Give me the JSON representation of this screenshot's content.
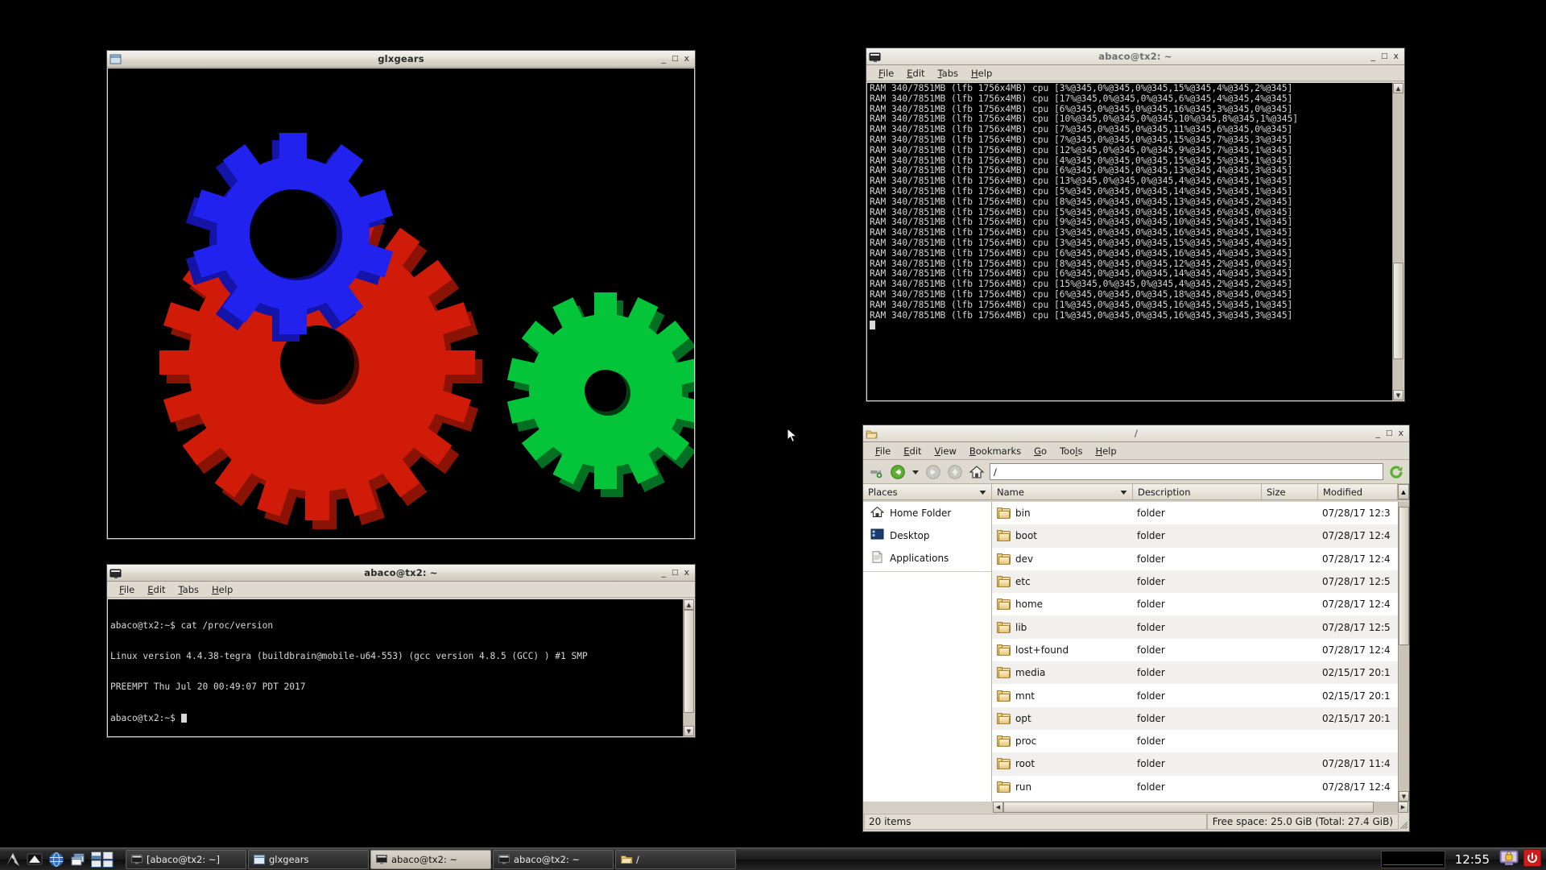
{
  "desktop": {
    "background_color": "#000000"
  },
  "glxgears_window": {
    "title": "glxgears",
    "icon": "window-icon",
    "buttons": {
      "minimize": "_",
      "maximize": "❐",
      "close": "x"
    },
    "gears": [
      {
        "name": "blue-gear",
        "color": "#2222ee",
        "shadow_color": "#1414a8",
        "teeth": 10
      },
      {
        "name": "red-gear",
        "color": "#d01b08",
        "shadow_color": "#7a1004",
        "teeth": 20
      },
      {
        "name": "green-gear",
        "color": "#04c43a",
        "shadow_color": "#036f23",
        "teeth": 14
      }
    ]
  },
  "terminal_top": {
    "title": "abaco@tx2: ~",
    "icon": "terminal-icon",
    "menu": [
      "File",
      "Edit",
      "Tabs",
      "Help"
    ],
    "buttons": {
      "minimize": "_",
      "maximize": "❐",
      "close": "x"
    },
    "lines": [
      "RAM 340/7851MB (lfb 1756x4MB) cpu [3%@345,0%@345,0%@345,15%@345,4%@345,2%@345]",
      "RAM 340/7851MB (lfb 1756x4MB) cpu [17%@345,0%@345,0%@345,6%@345,4%@345,4%@345]",
      "RAM 340/7851MB (lfb 1756x4MB) cpu [6%@345,0%@345,0%@345,16%@345,3%@345,0%@345]",
      "RAM 340/7851MB (lfb 1756x4MB) cpu [10%@345,0%@345,0%@345,10%@345,8%@345,1%@345]",
      "RAM 340/7851MB (lfb 1756x4MB) cpu [7%@345,0%@345,0%@345,11%@345,6%@345,0%@345]",
      "RAM 340/7851MB (lfb 1756x4MB) cpu [7%@345,0%@345,0%@345,15%@345,7%@345,3%@345]",
      "RAM 340/7851MB (lfb 1756x4MB) cpu [12%@345,0%@345,0%@345,9%@345,7%@345,1%@345]",
      "RAM 340/7851MB (lfb 1756x4MB) cpu [4%@345,0%@345,0%@345,15%@345,5%@345,1%@345]",
      "RAM 340/7851MB (lfb 1756x4MB) cpu [6%@345,0%@345,0%@345,13%@345,4%@345,3%@345]",
      "RAM 340/7851MB (lfb 1756x4MB) cpu [13%@345,0%@345,0%@345,4%@345,6%@345,1%@345]",
      "RAM 340/7851MB (lfb 1756x4MB) cpu [5%@345,0%@345,0%@345,14%@345,5%@345,1%@345]",
      "RAM 340/7851MB (lfb 1756x4MB) cpu [8%@345,0%@345,0%@345,13%@345,6%@345,2%@345]",
      "RAM 340/7851MB (lfb 1756x4MB) cpu [5%@345,0%@345,0%@345,16%@345,6%@345,0%@345]",
      "RAM 340/7851MB (lfb 1756x4MB) cpu [9%@345,0%@345,0%@345,10%@345,5%@345,1%@345]",
      "RAM 340/7851MB (lfb 1756x4MB) cpu [3%@345,0%@345,0%@345,16%@345,8%@345,1%@345]",
      "RAM 340/7851MB (lfb 1756x4MB) cpu [3%@345,0%@345,0%@345,15%@345,5%@345,4%@345]",
      "RAM 340/7851MB (lfb 1756x4MB) cpu [6%@345,0%@345,0%@345,16%@345,4%@345,3%@345]",
      "RAM 340/7851MB (lfb 1756x4MB) cpu [8%@345,0%@345,0%@345,12%@345,2%@345,0%@345]",
      "RAM 340/7851MB (lfb 1756x4MB) cpu [6%@345,0%@345,0%@345,14%@345,4%@345,3%@345]",
      "RAM 340/7851MB (lfb 1756x4MB) cpu [15%@345,0%@345,0%@345,4%@345,2%@345,2%@345]",
      "RAM 340/7851MB (lfb 1756x4MB) cpu [6%@345,0%@345,0%@345,18%@345,8%@345,0%@345]",
      "RAM 340/7851MB (lfb 1756x4MB) cpu [1%@345,0%@345,0%@345,16%@345,5%@345,1%@345]",
      "RAM 340/7851MB (lfb 1756x4MB) cpu [1%@345,0%@345,0%@345,16%@345,3%@345,3%@345]"
    ]
  },
  "terminal_bottom": {
    "title": "abaco@tx2: ~",
    "icon": "terminal-icon",
    "menu": [
      "File",
      "Edit",
      "Tabs",
      "Help"
    ],
    "buttons": {
      "minimize": "_",
      "maximize": "❐",
      "close": "x"
    },
    "lines": [
      "abaco@tx2:~$ cat /proc/version",
      "Linux version 4.4.38-tegra (buildbrain@mobile-u64-553) (gcc version 4.8.5 (GCC) ) #1 SMP",
      "PREEMPT Thu Jul 20 00:49:07 PDT 2017"
    ],
    "prompt": "abaco@tx2:~$ "
  },
  "file_manager": {
    "title": "/",
    "icon": "file-manager-icon",
    "buttons": {
      "minimize": "_",
      "maximize": "❐",
      "close": "x"
    },
    "menu": [
      "File",
      "Edit",
      "View",
      "Bookmarks",
      "Go",
      "Tools",
      "Help"
    ],
    "toolbar_icons": [
      "new-tab-icon",
      "back-icon",
      "history-dropdown-icon",
      "forward-icon",
      "up-icon",
      "home-icon",
      "reload-icon"
    ],
    "path_value": "/",
    "places": {
      "header": "Places",
      "items": [
        {
          "label": "Home Folder",
          "icon": "home-icon"
        },
        {
          "label": "Desktop",
          "icon": "desktop-icon"
        },
        {
          "label": "Applications",
          "icon": "applications-icon"
        }
      ]
    },
    "columns": [
      "Name",
      "Description",
      "Size",
      "Modified"
    ],
    "rows": [
      {
        "name": "bin",
        "description": "folder",
        "size": "",
        "modified": "07/28/17 12:3"
      },
      {
        "name": "boot",
        "description": "folder",
        "size": "",
        "modified": "07/28/17 12:4"
      },
      {
        "name": "dev",
        "description": "folder",
        "size": "",
        "modified": "07/28/17 12:4"
      },
      {
        "name": "etc",
        "description": "folder",
        "size": "",
        "modified": "07/28/17 12:5"
      },
      {
        "name": "home",
        "description": "folder",
        "size": "",
        "modified": "07/28/17 12:4"
      },
      {
        "name": "lib",
        "description": "folder",
        "size": "",
        "modified": "07/28/17 12:5"
      },
      {
        "name": "lost+found",
        "description": "folder",
        "size": "",
        "modified": "07/28/17 12:4"
      },
      {
        "name": "media",
        "description": "folder",
        "size": "",
        "modified": "02/15/17 20:1"
      },
      {
        "name": "mnt",
        "description": "folder",
        "size": "",
        "modified": "02/15/17 20:1"
      },
      {
        "name": "opt",
        "description": "folder",
        "size": "",
        "modified": "02/15/17 20:1"
      },
      {
        "name": "proc",
        "description": "folder",
        "size": "",
        "modified": ""
      },
      {
        "name": "root",
        "description": "folder",
        "size": "",
        "modified": "07/28/17 11:4"
      },
      {
        "name": "run",
        "description": "folder",
        "size": "",
        "modified": "07/28/17 12:4"
      }
    ],
    "status": {
      "item_count": "20 items",
      "free_space": "Free space: 25.0 GiB (Total: 27.4 GiB)"
    }
  },
  "taskbar": {
    "launchers": [
      "app-menu-icon",
      "terminal-icon",
      "web-browser-icon",
      "window-list-icon",
      "workspace-switcher-icon"
    ],
    "tasks": [
      {
        "label": "[abaco@tx2: ~]",
        "icon": "terminal-icon",
        "active": false
      },
      {
        "label": "glxgears",
        "icon": "glxgears-icon",
        "active": false
      },
      {
        "label": "abaco@tx2: ~",
        "icon": "terminal-icon",
        "active": true
      },
      {
        "label": "abaco@tx2: ~",
        "icon": "terminal-icon",
        "active": false
      },
      {
        "label": "/",
        "icon": "file-manager-icon",
        "active": false
      }
    ],
    "clock": "12:55",
    "tray": [
      "cpu-graph-monitor",
      "lock-screen-icon",
      "power-icon"
    ]
  }
}
